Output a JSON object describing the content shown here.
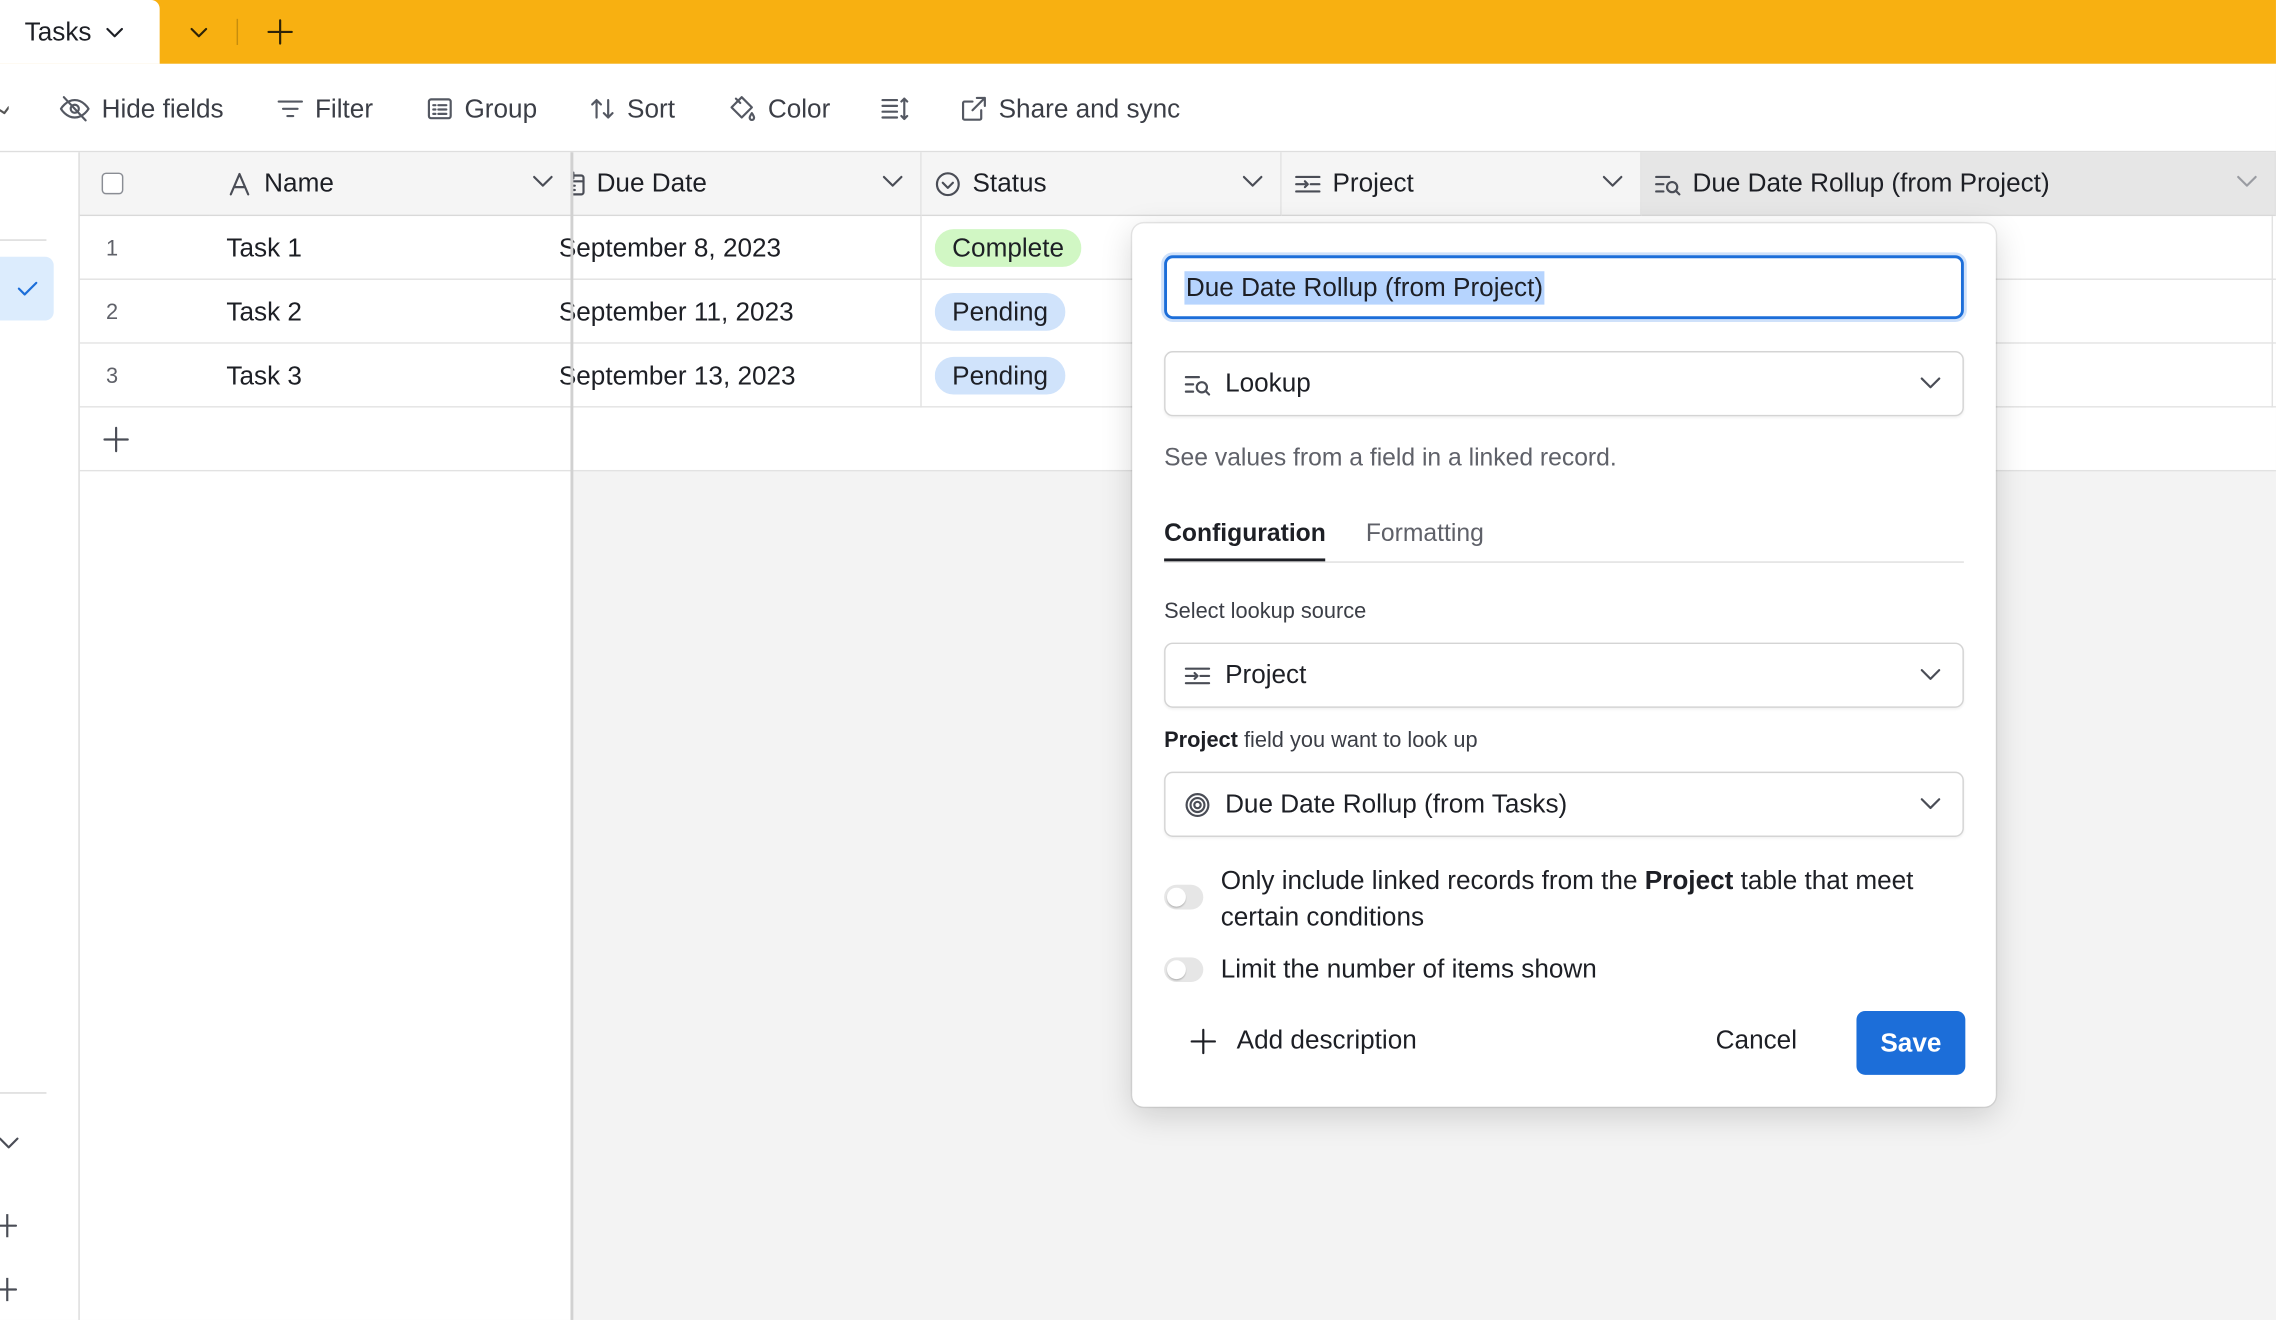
{
  "topbar": {
    "tab_label": "Tasks",
    "color": "#f8b011"
  },
  "toolbar": {
    "hide_fields": "Hide fields",
    "filter": "Filter",
    "group": "Group",
    "sort": "Sort",
    "color": "Color",
    "share": "Share and sync"
  },
  "grid": {
    "columns": [
      "Name",
      "Due Date",
      "Status",
      "Project",
      "Due Date Rollup (from Project)"
    ],
    "rows": [
      {
        "num": "1",
        "name": "Task 1",
        "due": "September 8, 2023",
        "status": "Complete"
      },
      {
        "num": "2",
        "name": "Task 2",
        "due": "September 11, 2023",
        "status": "Pending"
      },
      {
        "num": "3",
        "name": "Task 3",
        "due": "September 13, 2023",
        "status": "Pending"
      }
    ],
    "status_colors": {
      "Complete": "#d1f7c4",
      "Pending": "#d0e3fb"
    }
  },
  "popover": {
    "field_name": "Due Date Rollup (from Project)",
    "field_type": "Lookup",
    "type_description": "See values from a field in a linked record.",
    "tab_config": "Configuration",
    "tab_format": "Formatting",
    "source_label": "Select lookup source",
    "source_value": "Project",
    "lookup_label_bold": "Project",
    "lookup_label_rest": " field you want to look up",
    "lookup_value": "Due Date Rollup (from Tasks)",
    "toggle1_pre": "Only include linked records from the ",
    "toggle1_bold": "Project",
    "toggle1_post": " table that meet certain conditions",
    "toggle2": "Limit the number of items shown",
    "add_description": "Add description",
    "cancel": "Cancel",
    "save": "Save",
    "accent": "#1c6ed9"
  }
}
